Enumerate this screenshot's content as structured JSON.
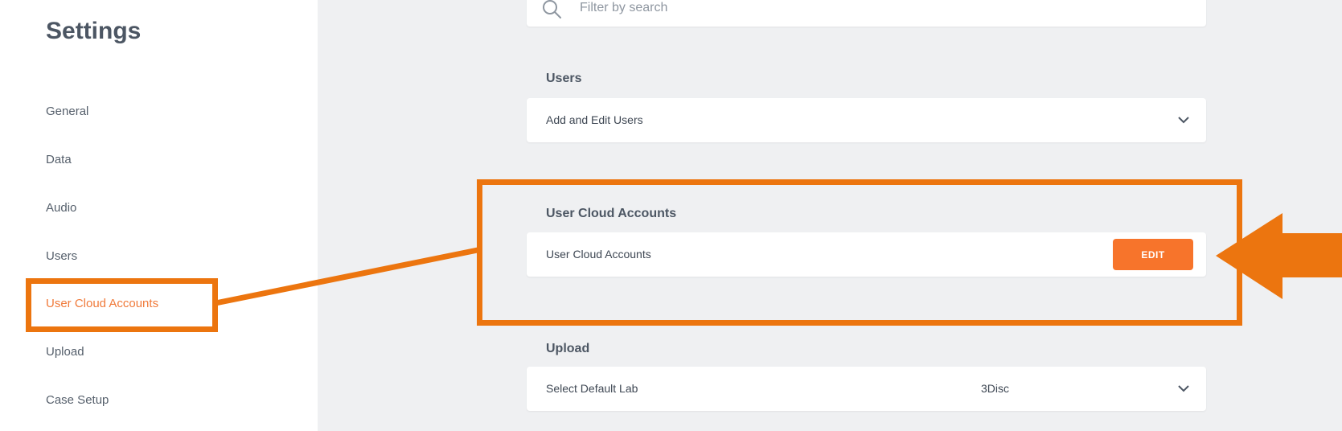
{
  "sidebar": {
    "title": "Settings",
    "items": [
      {
        "label": "General"
      },
      {
        "label": "Data"
      },
      {
        "label": "Audio"
      },
      {
        "label": "Users"
      },
      {
        "label": "User Cloud Accounts"
      },
      {
        "label": "Upload"
      },
      {
        "label": "Case Setup"
      }
    ],
    "active_index": 4
  },
  "search": {
    "placeholder": "Filter by search",
    "icon": "search-icon"
  },
  "sections": {
    "users": {
      "title": "Users",
      "row_label": "Add and Edit Users",
      "control_icon": "chevron-down-icon"
    },
    "cloud": {
      "title": "User Cloud Accounts",
      "row_label": "User Cloud Accounts",
      "button_label": "EDIT"
    },
    "upload": {
      "title": "Upload",
      "row_label": "Select Default Lab",
      "row_value": "3Disc",
      "control_icon": "chevron-down-icon"
    }
  },
  "colors": {
    "accent": "#f7742b",
    "annotation": "#ec750f",
    "active_nav": "#f07a3a",
    "main_background": "#eff0f2"
  }
}
